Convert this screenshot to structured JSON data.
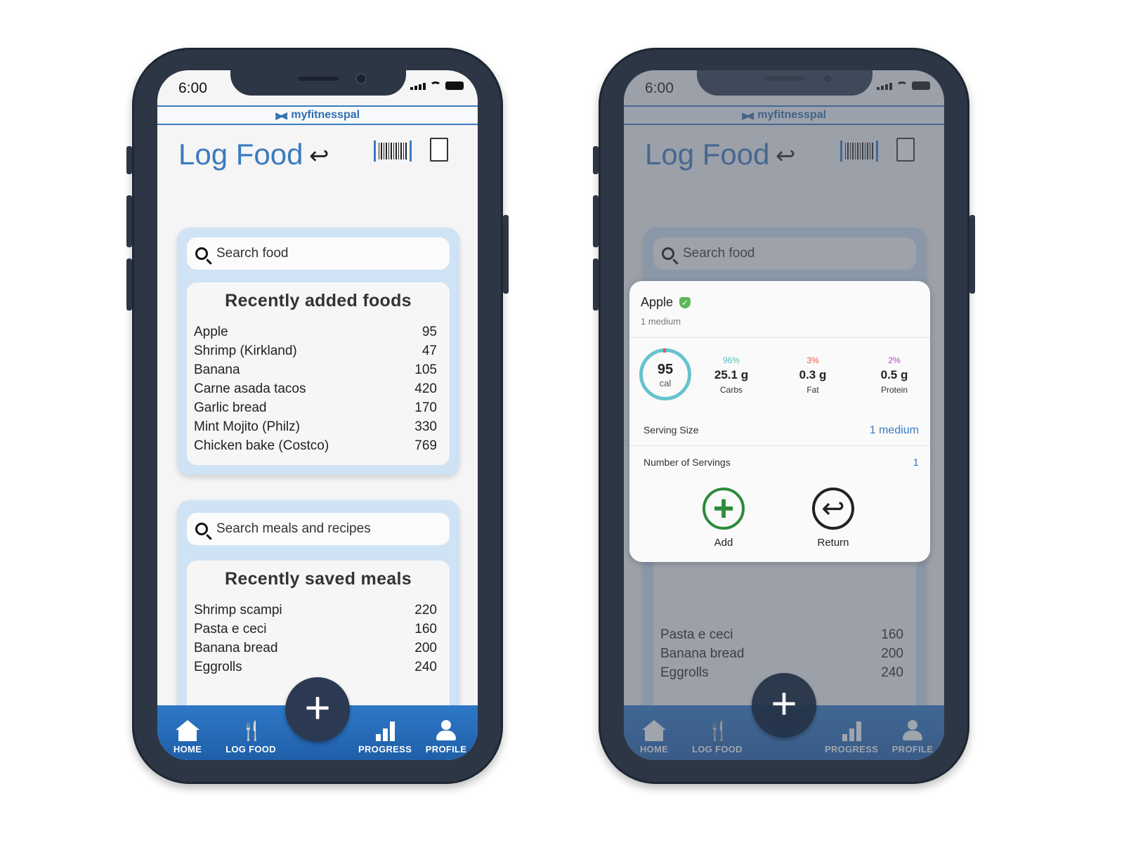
{
  "status": {
    "time": "6:00"
  },
  "brand": {
    "name": "myfitnesspal",
    "logo": "ua-logo"
  },
  "header": {
    "title": "Log Food",
    "back_icon": "return-arrow-icon",
    "barcode_icon": "barcode-icon",
    "copy_icon": "copy-icon"
  },
  "food_search": {
    "placeholder": "Search food"
  },
  "recent_foods": {
    "title": "Recently added foods",
    "items": [
      {
        "name": "Apple",
        "cal": "95"
      },
      {
        "name": "Shrimp (Kirkland)",
        "cal": "47"
      },
      {
        "name": "Banana",
        "cal": "105"
      },
      {
        "name": "Carne asada tacos",
        "cal": "420"
      },
      {
        "name": "Garlic bread",
        "cal": "170"
      },
      {
        "name": "Mint Mojito (Philz)",
        "cal": "330"
      },
      {
        "name": "Chicken bake (Costco)",
        "cal": "769"
      }
    ]
  },
  "meal_search": {
    "placeholder": "Search meals and recipes"
  },
  "saved_meals": {
    "title": "Recently saved meals",
    "items": [
      {
        "name": "Shrimp scampi",
        "cal": "220"
      },
      {
        "name": "Pasta e ceci",
        "cal": "160"
      },
      {
        "name": "Banana bread",
        "cal": "200"
      },
      {
        "name": "Eggrolls",
        "cal": "240"
      }
    ]
  },
  "nav": {
    "home": "HOME",
    "log_food": "LOG FOOD",
    "progress": "PROGRESS",
    "profile": "PROFILE",
    "fab": "+"
  },
  "modal": {
    "food_name": "Apple",
    "serving_desc": "1 medium",
    "calories": "95",
    "cal_unit": "cal",
    "carbs": {
      "pct": "96%",
      "grams": "25.1 g",
      "label": "Carbs",
      "color": "#4fc0c9"
    },
    "fat": {
      "pct": "3%",
      "grams": "0.3 g",
      "label": "Fat",
      "color": "#e05a4e"
    },
    "protein": {
      "pct": "2%",
      "grams": "0.5 g",
      "label": "Protein",
      "color": "#a34fbf"
    },
    "serving_size_label": "Serving Size",
    "serving_size_value": "1 medium",
    "num_servings_label": "Number of Servings",
    "num_servings_value": "1",
    "add_label": "Add",
    "return_label": "Return"
  },
  "colors": {
    "accent": "#3a7bbf",
    "frame": "#2d3645",
    "nav": "#2e78c7",
    "card": "#cfe3f4"
  }
}
